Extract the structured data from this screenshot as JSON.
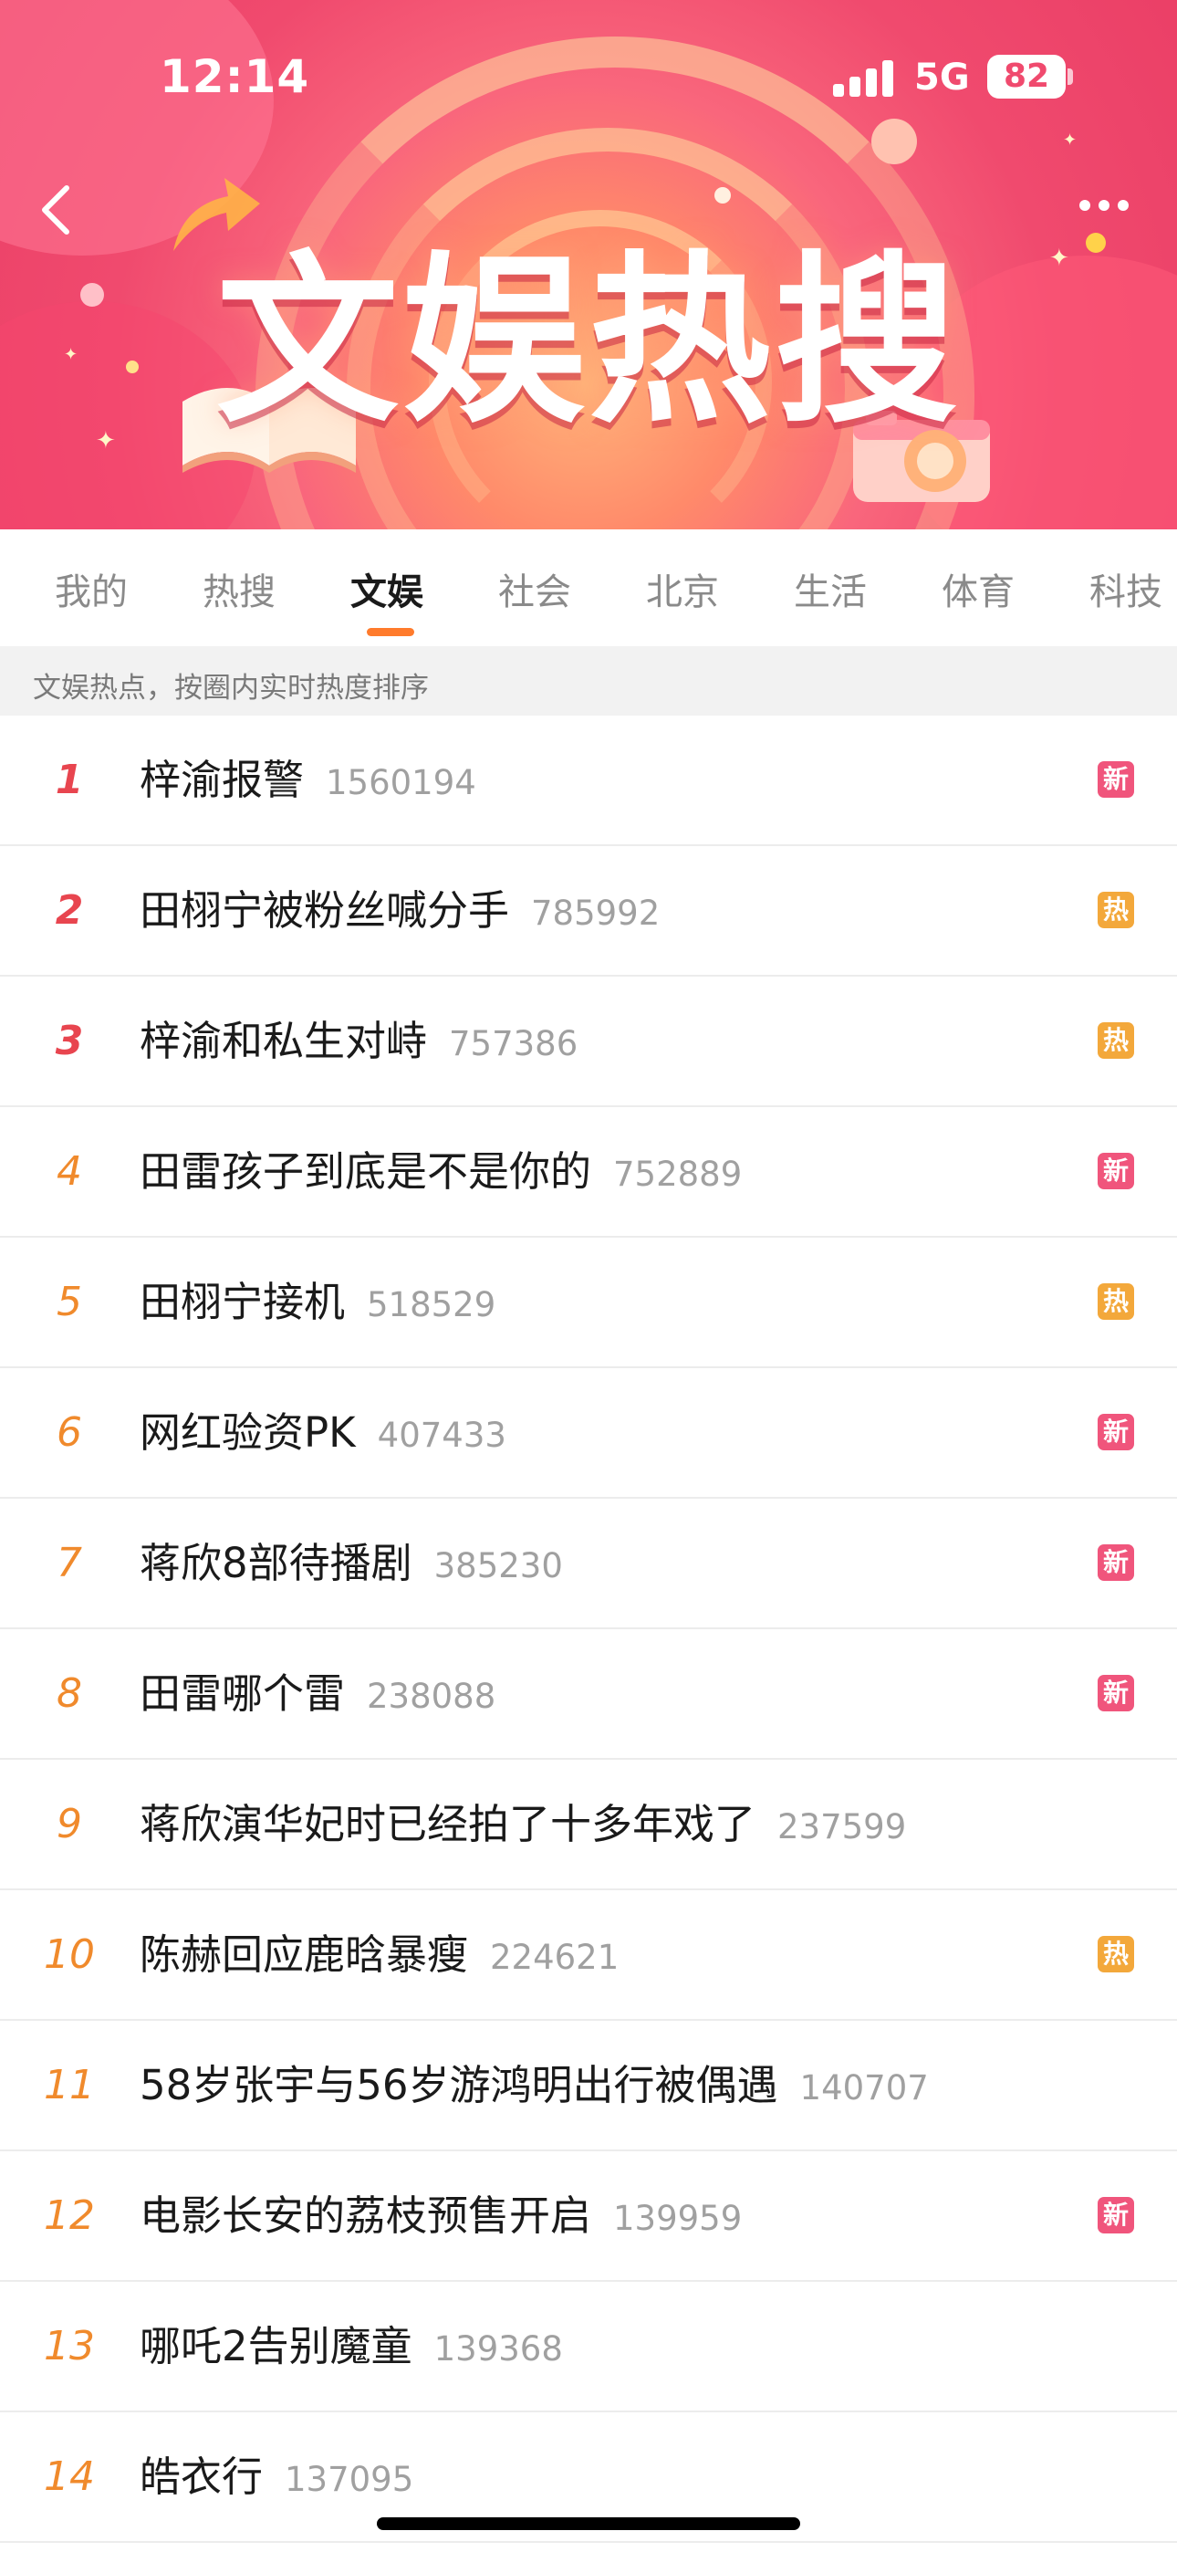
{
  "status_bar": {
    "time": "12:14",
    "network": "5G",
    "battery": "82"
  },
  "banner": {
    "title": "文娱热搜"
  },
  "tabs": [
    {
      "label": "我的"
    },
    {
      "label": "热搜"
    },
    {
      "label": "文娱"
    },
    {
      "label": "社会"
    },
    {
      "label": "北京"
    },
    {
      "label": "生活"
    },
    {
      "label": "体育"
    },
    {
      "label": "科技"
    }
  ],
  "active_tab": "文娱",
  "subheader": "文娱热点，按圈内实时热度排序",
  "list": [
    {
      "rank": "1",
      "title": "梓渝报警",
      "count": "1560194",
      "badge": "新",
      "badge_type": "new"
    },
    {
      "rank": "2",
      "title": "田栩宁被粉丝喊分手",
      "count": "785992",
      "badge": "热",
      "badge_type": "hot"
    },
    {
      "rank": "3",
      "title": "梓渝和私生对峙",
      "count": "757386",
      "badge": "热",
      "badge_type": "hot"
    },
    {
      "rank": "4",
      "title": "田雷孩子到底是不是你的",
      "count": "752889",
      "badge": "新",
      "badge_type": "new"
    },
    {
      "rank": "5",
      "title": "田栩宁接机",
      "count": "518529",
      "badge": "热",
      "badge_type": "hot"
    },
    {
      "rank": "6",
      "title": "网红验资PK",
      "count": "407433",
      "badge": "新",
      "badge_type": "new"
    },
    {
      "rank": "7",
      "title": "蒋欣8部待播剧",
      "count": "385230",
      "badge": "新",
      "badge_type": "new"
    },
    {
      "rank": "8",
      "title": "田雷哪个雷",
      "count": "238088",
      "badge": "新",
      "badge_type": "new"
    },
    {
      "rank": "9",
      "title": "蒋欣演华妃时已经拍了十多年戏了",
      "count": "237599",
      "badge": "",
      "badge_type": "none"
    },
    {
      "rank": "10",
      "title": "陈赫回应鹿晗暴瘦",
      "count": "224621",
      "badge": "热",
      "badge_type": "hot"
    },
    {
      "rank": "11",
      "title": "58岁张宇与56岁游鸿明出行被偶遇",
      "count": "140707",
      "badge": "",
      "badge_type": "none"
    },
    {
      "rank": "12",
      "title": "电影长安的荔枝预售开启",
      "count": "139959",
      "badge": "新",
      "badge_type": "new"
    },
    {
      "rank": "13",
      "title": "哪吒2告别魔童",
      "count": "139368",
      "badge": "",
      "badge_type": "none"
    },
    {
      "rank": "14",
      "title": "皓衣行",
      "count": "137095",
      "badge": "",
      "badge_type": "none"
    }
  ],
  "colors": {
    "accent": "#ff7b2c",
    "rank_top": "#e8454f",
    "rank_rest": "#f08a2c",
    "badge_new": "#f0557c",
    "badge_hot": "#f3a83b"
  }
}
